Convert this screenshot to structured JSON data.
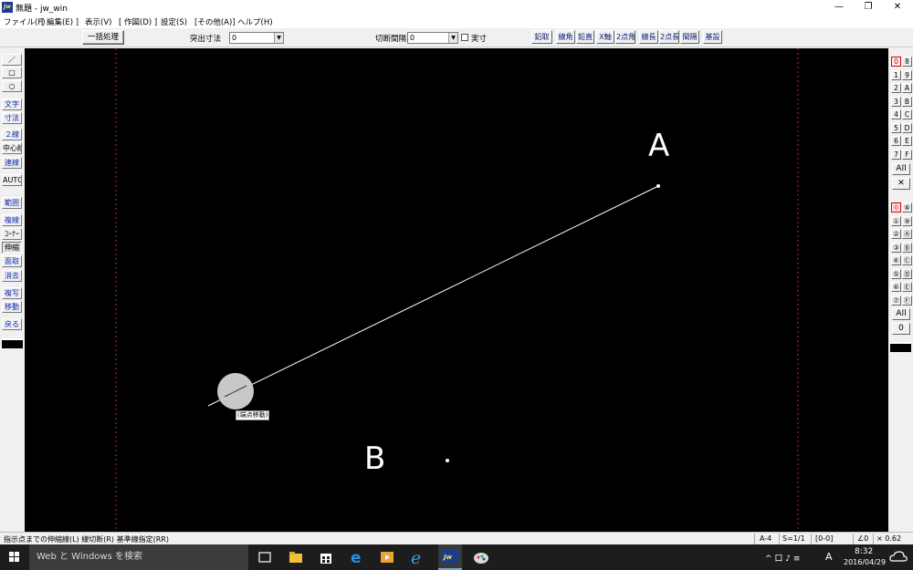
{
  "window": {
    "title": "無題 - jw_win",
    "app_icon_text": "Jw",
    "minimize": "—",
    "restore": "❐",
    "close": "✕"
  },
  "menu": [
    "ファイル(F)",
    "[ 編集(E) ]",
    "表示(V)",
    "[ 作図(D) ]",
    "設定(S)",
    "[その他(A)]",
    "ヘルプ(H)"
  ],
  "toolbar": {
    "batch_button": "一括処理",
    "protrude_label": "突出寸法",
    "protrude_value": "0",
    "cut_interval_label": "切断間隔",
    "cut_interval_value": "0",
    "actual_size_label": "実寸",
    "buttons": [
      "鉛取",
      "線角",
      "鉛直",
      "X軸",
      "2点角",
      "線長",
      "2点長",
      "間隔",
      "基設"
    ]
  },
  "left_tools": [
    {
      "label": "／",
      "style": "plain"
    },
    {
      "label": "□",
      "style": "plain"
    },
    {
      "label": "○",
      "style": "plain"
    },
    {
      "label": "文字",
      "style": "blue"
    },
    {
      "label": "寸法",
      "style": "blue"
    },
    {
      "label": "２線",
      "style": "blue"
    },
    {
      "label": "中心線",
      "style": "plain"
    },
    {
      "label": "連線",
      "style": "blue"
    },
    {
      "label": "AUTO",
      "style": "plain"
    },
    {
      "label": "範囲",
      "style": "blue"
    },
    {
      "label": "複線",
      "style": "blue"
    },
    {
      "label": "ｺｰﾅｰ",
      "style": "plain"
    },
    {
      "label": "伸縮",
      "style": "pressed"
    },
    {
      "label": "面取",
      "style": "blue"
    },
    {
      "label": "消去",
      "style": "blue"
    },
    {
      "label": "複写",
      "style": "blue"
    },
    {
      "label": "移動",
      "style": "blue"
    },
    {
      "label": "戻る",
      "style": "blue"
    }
  ],
  "right_layer_groups": {
    "group_buttons": [
      "0",
      "8",
      "1",
      "9",
      "2",
      "A",
      "3",
      "B",
      "4",
      "C",
      "5",
      "D",
      "6",
      "E",
      "7",
      "F"
    ],
    "group_all": "All",
    "group_cross": "✕",
    "layer_buttons": [
      "⓪",
      "⑧",
      "①",
      "⑨",
      "②",
      "Ⓐ",
      "③",
      "Ⓑ",
      "④",
      "Ⓒ",
      "⑤",
      "Ⓓ",
      "⑥",
      "Ⓔ",
      "⑦",
      "Ⓕ"
    ],
    "layer_all": "All",
    "layer_zero": "0"
  },
  "canvas": {
    "label_a": "A",
    "label_b": "B",
    "cursor_tag": "(端点移動)",
    "background": "#000000",
    "line_color": "#ffffff",
    "guide_color": "#b0208a"
  },
  "status": {
    "message": "指示点までの伸縮線(L)  線切断(R)  基準線指定(RR)",
    "paper": "A-4",
    "scale": "S=1/1",
    "layer": "[0-0]",
    "angle": "∠0",
    "zoom": "× 0.62"
  },
  "taskbar": {
    "search_placeholder": "Web と Windows を検索",
    "time": "8:32",
    "date": "2016/04/29",
    "ime": "A",
    "tray_symbols": "^ 口 ♪ ≡"
  }
}
